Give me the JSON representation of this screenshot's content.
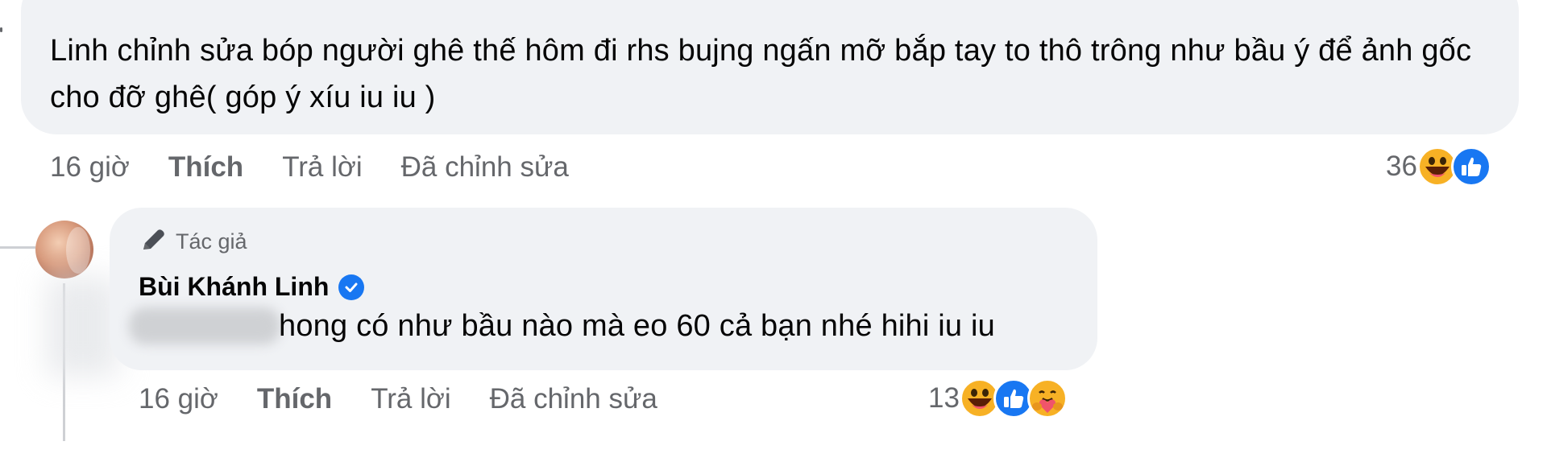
{
  "top_comment": {
    "text": "Linh chỉnh sửa bóp người ghê thế hôm đi rhs bujng ngấn mỡ bắp tay to thô trông như bầu ý để ảnh gốc cho đỡ ghê( góp ý xíu iu iu )",
    "time": "16 giờ",
    "like_label": "Thích",
    "reply_label": "Trả lời",
    "edited_label": "Đã chỉnh sửa",
    "reaction_count": "36",
    "reaction_icons": [
      "haha-icon",
      "like-icon"
    ]
  },
  "reply": {
    "author_badge": "Tác giả",
    "author_name": "Bùi Khánh Linh",
    "text": "hong có như bầu nào mà eo 60 cả bạn nhé hihi iu iu",
    "time": "16 giờ",
    "like_label": "Thích",
    "reply_label": "Trả lời",
    "edited_label": "Đã chỉnh sửa",
    "reaction_count": "13",
    "reaction_icons": [
      "haha-icon",
      "like-icon",
      "care-icon"
    ]
  },
  "colors": {
    "bubble_bg": "#f0f2f5",
    "meta_text": "#65676b",
    "like_blue": "#1877f2",
    "haha_yellow": "#f7b125"
  }
}
